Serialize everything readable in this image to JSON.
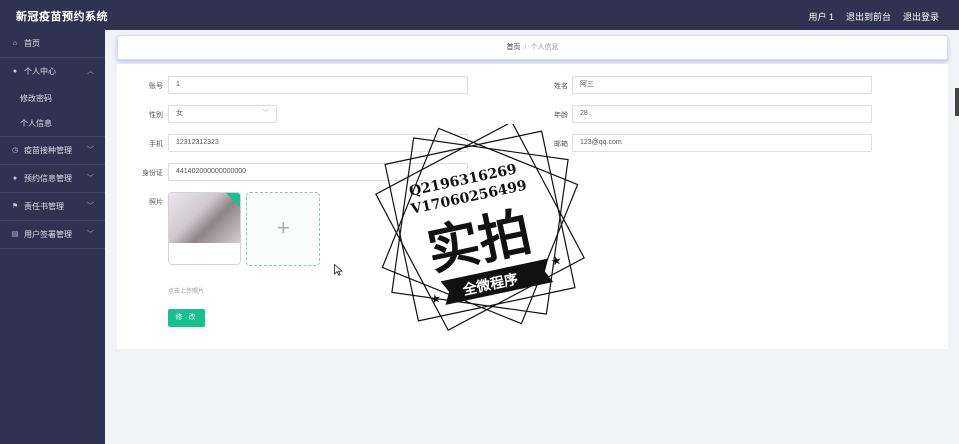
{
  "app": {
    "title": "新冠疫苗预约系统"
  },
  "header": {
    "user": "用户 1",
    "back_front": "退出到前台",
    "logout": "退出登录"
  },
  "sidebar": {
    "home": "首页",
    "personal_center": "个人中心",
    "change_password": "修改密码",
    "profile": "个人信息",
    "vaccine_mgmt": "疫苗接种管理",
    "booking_mgmt": "预约信息管理",
    "responsibility_mgmt": "责任书管理",
    "user_sign_mgmt": "用户签署管理"
  },
  "breadcrumb": {
    "home": "首页",
    "separator": "/",
    "current": "个人信息"
  },
  "form": {
    "account_label": "账号",
    "account_value": "1",
    "name_label": "姓名",
    "name_value": "阿三",
    "gender_label": "性别",
    "gender_value": "女",
    "age_label": "年龄",
    "age_value": "28",
    "phone_label": "手机",
    "phone_value": "12312312323",
    "email_label": "邮箱",
    "email_value": "123@qq.com",
    "idcard_label": "身份证",
    "idcard_value": "441402000000000000",
    "photo_label": "照片",
    "upload_hint": "点击上传照片",
    "submit": "修 改"
  },
  "watermark": {
    "line1": "Q2196316269",
    "line2": "V17060256499",
    "main": "实拍",
    "ribbon": "全微程序"
  },
  "colors": {
    "sidebar": "#2f3350",
    "accent": "#13c28e"
  }
}
